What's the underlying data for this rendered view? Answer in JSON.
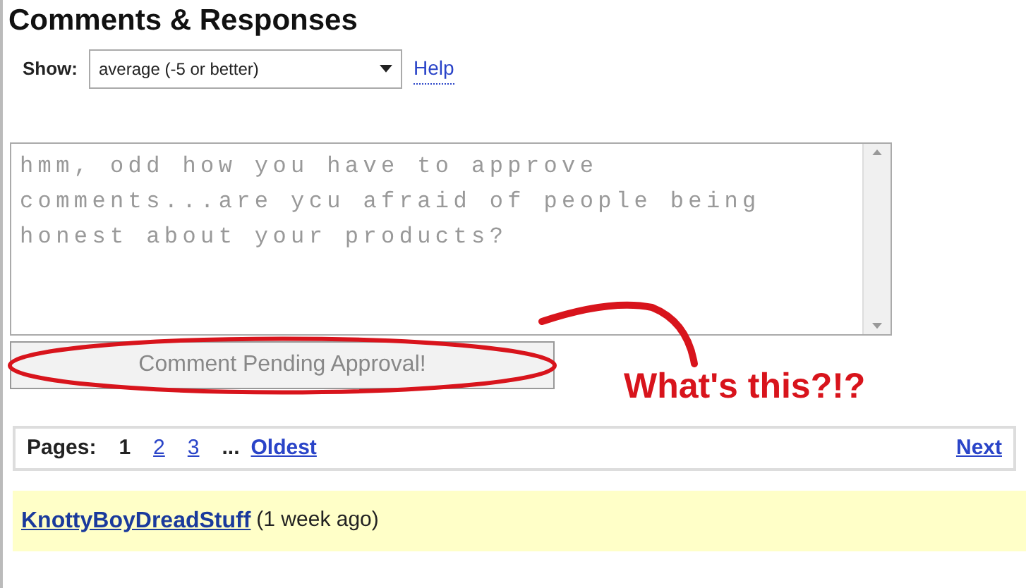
{
  "heading": "Comments & Responses",
  "filter": {
    "label": "Show:",
    "value": "average (-5 or better)",
    "help": "Help"
  },
  "comment_box": {
    "value": "hmm, odd how you have to approve comments...are ycu afraid of people being honest about your products?"
  },
  "submit_button": {
    "label": "Comment Pending Approval!",
    "disabled": true
  },
  "annotation": {
    "text": "What's this?!?",
    "color": "#d8141c"
  },
  "pagination": {
    "label": "Pages:",
    "pages": [
      {
        "label": "1",
        "selected": true
      },
      {
        "label": "2",
        "selected": false
      },
      {
        "label": "3",
        "selected": false
      }
    ],
    "ellipsis": "...",
    "oldest": "Oldest",
    "next": "Next"
  },
  "comment": {
    "author": "KnottyBoyDreadStuff",
    "time": "(1 week ago)"
  }
}
